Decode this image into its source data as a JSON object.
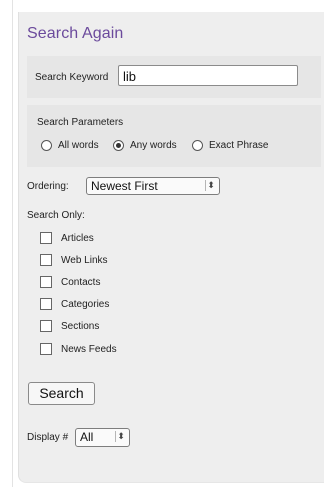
{
  "title": "Search Again",
  "keyword": {
    "label": "Search Keyword",
    "value": "lib"
  },
  "parameters": {
    "label": "Search Parameters",
    "options": [
      {
        "label": "All words",
        "selected": false
      },
      {
        "label": "Any words",
        "selected": true
      },
      {
        "label": "Exact Phrase",
        "selected": false
      }
    ]
  },
  "ordering": {
    "label": "Ordering:",
    "selected": "Newest First"
  },
  "search_only": {
    "label": "Search Only:",
    "items": [
      {
        "label": "Articles",
        "checked": false
      },
      {
        "label": "Web Links",
        "checked": false
      },
      {
        "label": "Contacts",
        "checked": false
      },
      {
        "label": "Categories",
        "checked": false
      },
      {
        "label": "Sections",
        "checked": false
      },
      {
        "label": "News Feeds",
        "checked": false
      }
    ]
  },
  "search_button": {
    "label": "Search"
  },
  "display": {
    "label": "Display #",
    "selected": "All"
  },
  "colors": {
    "title": "#6b4a9c",
    "panel": "#eeeeee",
    "group": "#e6e6e6"
  }
}
